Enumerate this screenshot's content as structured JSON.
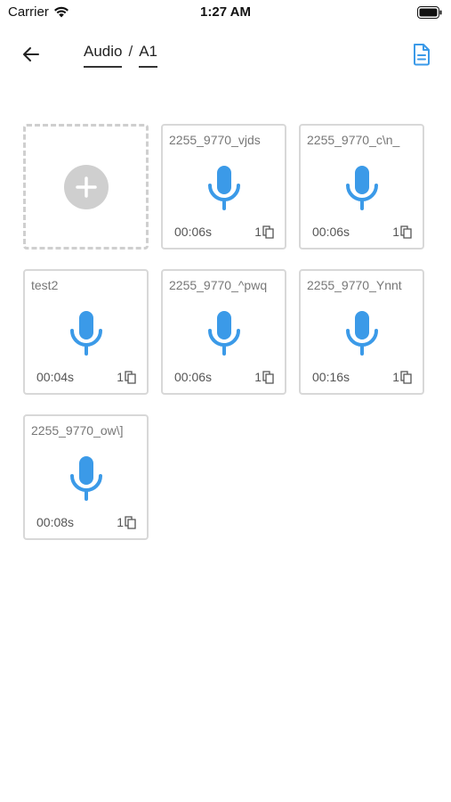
{
  "status_bar": {
    "carrier": "Carrier",
    "time": "1:27 AM",
    "wifi_icon": "wifi-icon",
    "battery_icon": "battery-icon"
  },
  "header": {
    "back_icon": "arrow-left-icon",
    "breadcrumb": [
      "Audio",
      "A1"
    ],
    "breadcrumb_separator": "/",
    "doc_icon": "document-icon"
  },
  "colors": {
    "accent": "#3b9ae8",
    "tile_border": "#d8d8d8",
    "add_gray": "#cfcfcf"
  },
  "items": [
    {
      "name": "2255_9770_vjds",
      "duration": "00:06s",
      "count": "1"
    },
    {
      "name": "2255_9770_c\\n_",
      "duration": "00:06s",
      "count": "1"
    },
    {
      "name": "test2",
      "duration": "00:04s",
      "count": "1"
    },
    {
      "name": "2255_9770_^pwq",
      "duration": "00:06s",
      "count": "1"
    },
    {
      "name": "2255_9770_Ynnt",
      "duration": "00:16s",
      "count": "1"
    },
    {
      "name": "2255_9770_ow\\]",
      "duration": "00:08s",
      "count": "1"
    }
  ]
}
